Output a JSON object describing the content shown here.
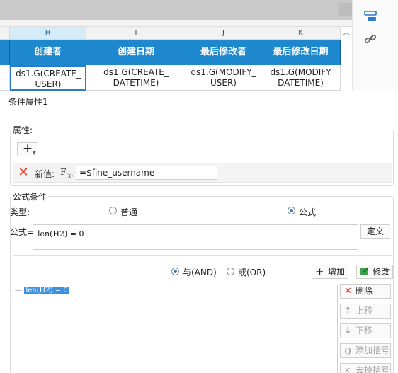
{
  "sheet": {
    "columns": [
      {
        "letter": "H",
        "header": "创建者",
        "cell_line1": "ds1.G(CREATE_",
        "cell_line2": "USER)"
      },
      {
        "letter": "I",
        "header": "创建日期",
        "cell_line1": "ds1.G(CREATE_",
        "cell_line2": "DATETIME)"
      },
      {
        "letter": "J",
        "header": "最后修改者",
        "cell_line1": "ds1.G(MODIFY_",
        "cell_line2": "USER)"
      },
      {
        "letter": "K",
        "header": "最后修改日期",
        "cell_line1": "ds1.G(MODIFY",
        "cell_line2": "DATETIME)"
      }
    ],
    "scroll_up_glyph": "︿"
  },
  "side_toolbar": {
    "items": [
      {
        "icon": "cell-attribute-icon",
        "active": true
      },
      {
        "icon": "link-icon",
        "active": false
      }
    ]
  },
  "dialog": {
    "title": "条件属性1",
    "attributes": {
      "label": "属性:",
      "add_glyph": "+",
      "rows": [
        {
          "name_label": "新值:",
          "fx_label": "F",
          "fx_sub": "(x)",
          "value": "=$fine_username"
        }
      ]
    },
    "formula_condition": {
      "label": "公式条件",
      "type_label": "类型:",
      "options": [
        {
          "label": "普通",
          "selected": false
        },
        {
          "label": "公式",
          "selected": true
        }
      ],
      "formula_label": "公式=",
      "formula_value": "len(H2) = 0",
      "define_button": "定义",
      "logic_options": [
        {
          "label": "与(AND)",
          "selected": true
        },
        {
          "label": "或(OR)",
          "selected": false
        }
      ],
      "add_button": "增加",
      "modify_button": "修改",
      "conditions": [
        {
          "dash": "—",
          "text": "len(H2) = 0"
        }
      ],
      "side_buttons": [
        {
          "label": "删除",
          "enabled": true,
          "icon": "delete-icon"
        },
        {
          "label": "上移",
          "enabled": false,
          "icon": "arrow-up-icon"
        },
        {
          "label": "下移",
          "enabled": false,
          "icon": "arrow-down-icon"
        },
        {
          "label": "添加括号",
          "enabled": false,
          "icon": "parentheses-icon"
        },
        {
          "label": "去掉括号",
          "enabled": false,
          "icon": "remove-parentheses-icon"
        }
      ]
    }
  },
  "colors": {
    "header_bg": "#1e88cf",
    "selection": "#2a7bd0",
    "delete_red": "#d83a2b",
    "highlight": "#3d8fe0"
  }
}
